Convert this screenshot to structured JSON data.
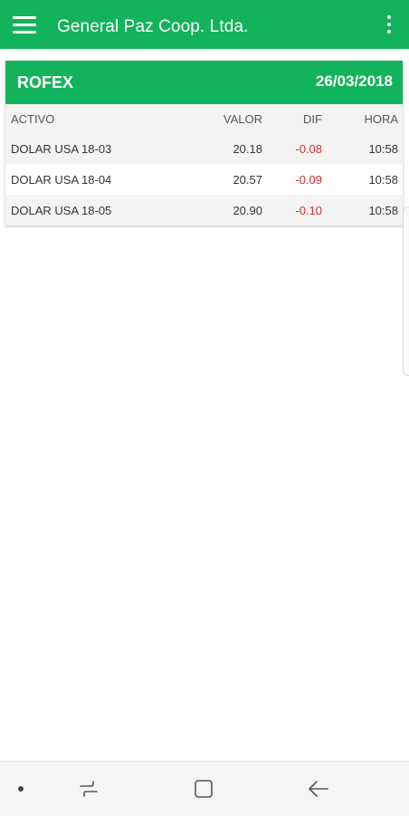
{
  "appbar": {
    "title": "General Paz Coop. Ltda.",
    "color": "#12b35a"
  },
  "card": {
    "title": "ROFEX",
    "date": "26/03/2018",
    "columns": [
      "ACTIVO",
      "VALOR",
      "DIF",
      "HORA"
    ],
    "rows": [
      {
        "activo": "DOLAR USA 18-03",
        "valor": "20.18",
        "dif": "-0.08",
        "hora": "10:58"
      },
      {
        "activo": "DOLAR USA 18-04",
        "valor": "20.57",
        "dif": "-0.09",
        "hora": "10:58"
      },
      {
        "activo": "DOLAR USA 18-05",
        "valor": "20.90",
        "dif": "-0.10",
        "hora": "10:58"
      }
    ],
    "negative_color": "#d32f2f"
  },
  "icons": {
    "menu": "hamburger-menu-icon",
    "overflow": "more-vert-icon",
    "nav_dot": "dot-icon",
    "nav_recent": "recent-apps-icon",
    "nav_home": "home-icon",
    "nav_back": "back-arrow-icon"
  }
}
